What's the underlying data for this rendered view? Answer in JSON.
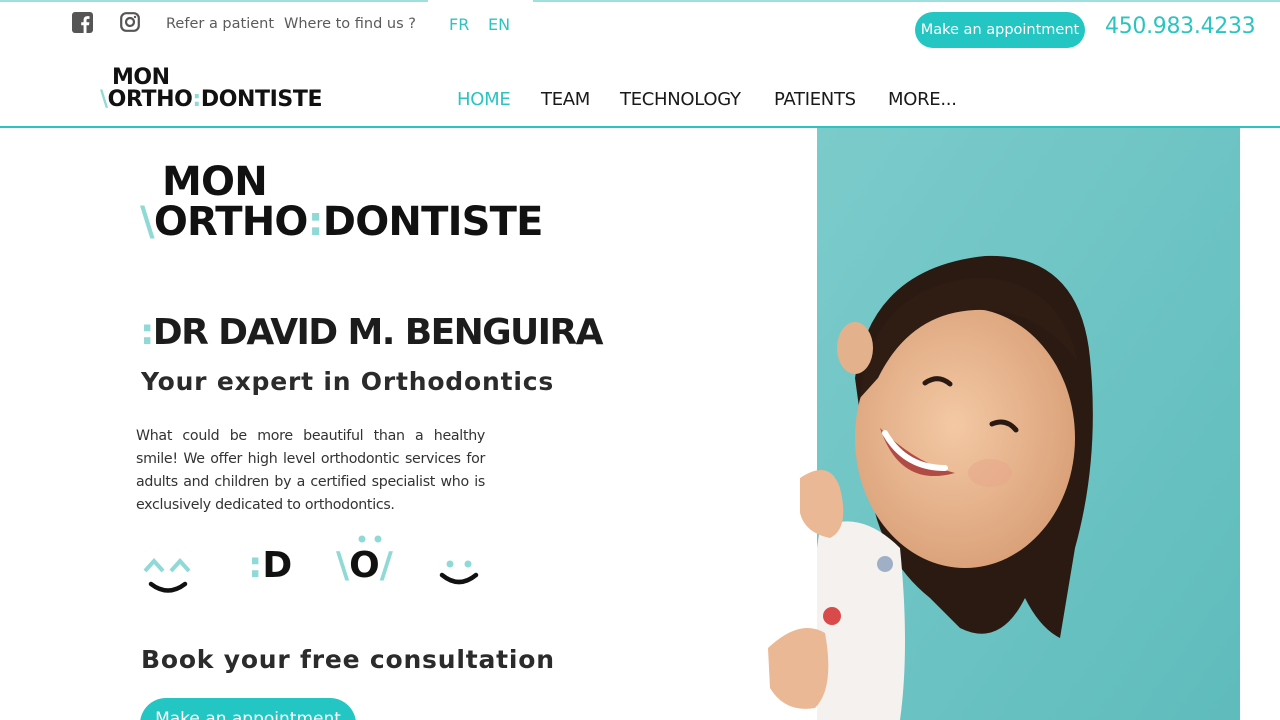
{
  "header": {
    "social": [
      "facebook-icon",
      "instagram-icon"
    ],
    "links": [
      "Refer a patient",
      "Where to find us ?"
    ],
    "languages": [
      "FR",
      "EN"
    ],
    "appointment_label": "Make an appointment",
    "phone": "450.983.4233"
  },
  "logo": {
    "line1": "MON",
    "slash": "\\",
    "word1": "ORTHO",
    "colon": ":",
    "word2": "DONTISTE"
  },
  "nav": {
    "items": [
      "HOME",
      "TEAM",
      "TECHNOLOGY",
      "PATIENTS",
      "MORE..."
    ],
    "active": "HOME"
  },
  "hero": {
    "colon": ":",
    "doctor": "DR DAVID M. BENGUIRA",
    "tagline": "Your expert in Orthodontics",
    "intro": "What could be more beautiful than a healthy smile! We offer high level orthodontic services for adults and children by a certified specialist who is exclusively dedicated to orthodontics.",
    "emoticons": {
      "e2_colon": ":",
      "e2_letter": "D",
      "e3_left": "\\",
      "e3_letter": "O",
      "e3_right": "/"
    },
    "book_heading": "Book your free consultation",
    "book_button": "Make an appointment"
  },
  "photo": {
    "subject": "smiling child peeking from behind a teal wall",
    "background_color": "#6cc4c4"
  },
  "colors": {
    "accent": "#23c6c3",
    "light_accent": "#8fd9d6",
    "text": "#1a1a1a"
  }
}
